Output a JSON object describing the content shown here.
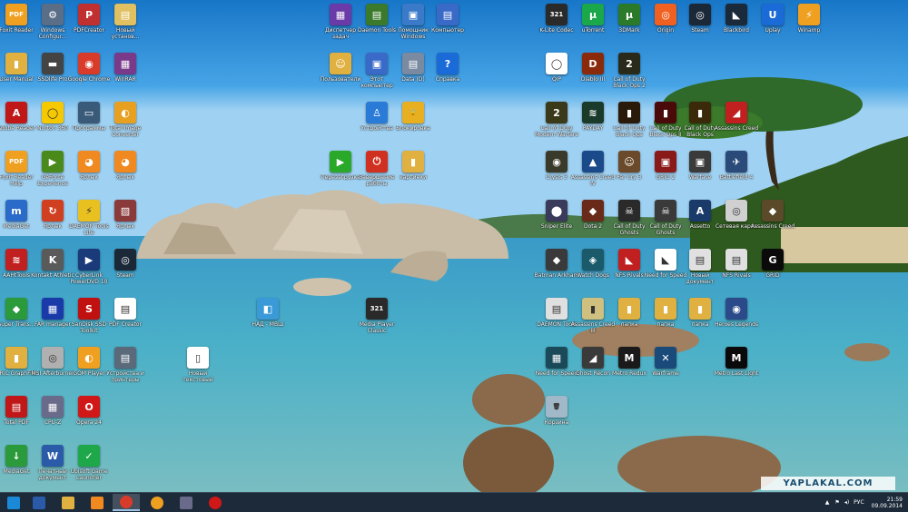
{
  "desktop": {
    "icons": [
      {
        "label": "Foxit Reader",
        "color": "#f0a020",
        "glyph": "PDF",
        "icon": "foxit-icon"
      },
      {
        "label": "Windows Configur...",
        "color": "#5a6e88",
        "glyph": "⚙",
        "icon": "settings-icon"
      },
      {
        "label": "PDFCreator",
        "color": "#c03030",
        "glyph": "P",
        "icon": "pdfcreator-icon"
      },
      {
        "label": "Новый установ...",
        "color": "#e0c060",
        "glyph": "▤",
        "icon": "document-icon"
      },
      {
        "label": "User Manual",
        "color": "#e0b040",
        "glyph": "▮",
        "icon": "folder-icon"
      },
      {
        "label": "SSDlife Pro",
        "color": "#444444",
        "glyph": "▬",
        "icon": "ssd-icon"
      },
      {
        "label": "Google Chrome",
        "color": "#d93b2b",
        "glyph": "◉",
        "icon": "chrome-icon"
      },
      {
        "label": "WinRAR",
        "color": "#7a3a8a",
        "glyph": "▦",
        "icon": "winrar-icon"
      },
      {
        "label": "Adobe Reader",
        "color": "#c01818",
        "glyph": "A",
        "icon": "adobe-reader-icon"
      },
      {
        "label": "Norton 360",
        "color": "#f5c800",
        "glyph": "◯",
        "icon": "norton-icon"
      },
      {
        "label": "Программы",
        "color": "#3a5a7a",
        "glyph": "▭",
        "icon": "programs-icon"
      },
      {
        "label": "Total Image Converter",
        "color": "#e8a020",
        "glyph": "◐",
        "icon": "converter-icon"
      },
      {
        "label": "Foxit Reader Help",
        "color": "#f0a020",
        "glyph": "PDF",
        "icon": "pdf-help-icon"
      },
      {
        "label": "GeForce Experience",
        "color": "#4a8a1a",
        "glyph": "▶",
        "icon": "geforce-icon"
      },
      {
        "label": "Ярлык",
        "color": "#f08a20",
        "glyph": "◕",
        "icon": "shortcut-icon"
      },
      {
        "label": "Ярлык",
        "color": "#f08a20",
        "glyph": "◕",
        "icon": "shortcut-icon"
      },
      {
        "label": "MediaGet",
        "color": "#2a6ac8",
        "glyph": "m",
        "icon": "mediaget-icon"
      },
      {
        "label": "Ярлык",
        "color": "#d04020",
        "glyph": "↻",
        "icon": "shortcut-icon"
      },
      {
        "label": "DAEMON Tools Lite",
        "color": "#e8c020",
        "glyph": "⚡",
        "icon": "daemon-icon"
      },
      {
        "label": "Ярлык",
        "color": "#8a3a3a",
        "glyph": "▨",
        "icon": "shortcut-icon"
      },
      {
        "label": "AAHtTools",
        "color": "#c02020",
        "glyph": "≋",
        "icon": "tools-icon"
      },
      {
        "label": "Kontakt Athletic",
        "color": "#5a5a5a",
        "glyph": "K",
        "icon": "k-icon"
      },
      {
        "label": "CyberLink PowerDVD 10",
        "color": "#1a3a7a",
        "glyph": "▶",
        "icon": "powerdvd-icon"
      },
      {
        "label": "Steam",
        "color": "#1b2838",
        "glyph": "◎",
        "icon": "steam-icon"
      },
      {
        "label": "Super Trans...",
        "color": "#2a9a3a",
        "glyph": "◆",
        "icon": "transfer-icon"
      },
      {
        "label": "FAR manager",
        "color": "#1a3aaa",
        "glyph": "▦",
        "icon": "far-icon"
      },
      {
        "label": "SanDisk SSD Toolkit",
        "color": "#c01010",
        "glyph": "S",
        "icon": "sandisk-icon"
      },
      {
        "label": "PDF Creator",
        "color": "#ffffff",
        "glyph": "▤",
        "icon": "pdf-icon"
      },
      {
        "label": "ERIC GraphFile",
        "color": "#e0b040",
        "glyph": "▮",
        "icon": "folder-icon"
      },
      {
        "label": "MSI Afterburner",
        "color": "#b0b0b0",
        "glyph": "◎",
        "icon": "afterburner-icon"
      },
      {
        "label": "GOM Player",
        "color": "#f0a020",
        "glyph": "◐",
        "icon": "gom-icon"
      },
      {
        "label": "Устройства и принтеры",
        "color": "#5a6a7a",
        "glyph": "▤",
        "icon": "printer-icon"
      },
      {
        "label": "Новый текстовый",
        "color": "#ffffff",
        "glyph": "▯",
        "icon": "text-file-icon"
      },
      {
        "label": "Total PDF",
        "color": "#c01818",
        "glyph": "▤",
        "icon": "pdf-icon"
      },
      {
        "label": "CPU-Z",
        "color": "#6a6a8a",
        "glyph": "▦",
        "icon": "cpuz-icon"
      },
      {
        "label": "Opera 24",
        "color": "#d01818",
        "glyph": "O",
        "icon": "opera-icon"
      },
      {
        "label": "MediaGet",
        "color": "#2a9a3a",
        "glyph": "↓",
        "icon": "mediaget-icon"
      },
      {
        "label": "Печатный документ",
        "color": "#2a5aa8",
        "glyph": "W",
        "icon": "word-icon"
      },
      {
        "label": "Ubisoft Game Launcher",
        "color": "#1fa84a",
        "glyph": "✓",
        "icon": "launcher-icon"
      },
      {
        "label": "Диспетчер задач",
        "color": "#6a3aa8",
        "glyph": "▦",
        "icon": "taskmgr-icon"
      },
      {
        "label": "Daemon Tools",
        "color": "#3a7a2a",
        "glyph": "▤",
        "icon": "image-icon"
      },
      {
        "label": "Помощник Windows",
        "color": "#3a7ac8",
        "glyph": "▣",
        "icon": "window-icon"
      },
      {
        "label": "Компьютер",
        "color": "#3a6ac8",
        "glyph": "▤",
        "icon": "computer-icon"
      },
      {
        "label": "Пользователи",
        "color": "#e0b040",
        "glyph": "☺",
        "icon": "users-icon"
      },
      {
        "label": "Этот компьютер",
        "color": "#3a6ac8",
        "glyph": "▣",
        "icon": "pc-icon"
      },
      {
        "label": "Data (D)",
        "color": "#7a8aa0",
        "glyph": "▤",
        "icon": "disk-icon"
      },
      {
        "label": "Справка",
        "color": "#1a6ad8",
        "glyph": "?",
        "icon": "help-icon"
      },
      {
        "label": "Устройства",
        "color": "#2a7ad8",
        "glyph": "♙",
        "icon": "devices-icon"
      },
      {
        "label": "Блокировка",
        "color": "#e8b020",
        "glyph": "🔒",
        "icon": "lock-icon"
      },
      {
        "label": "Перезагрузка",
        "color": "#2aa82a",
        "glyph": "▶",
        "icon": "restart-icon"
      },
      {
        "label": "Завершение работы",
        "color": "#d03020",
        "glyph": "⏻",
        "icon": "power-icon"
      },
      {
        "label": "картинки",
        "color": "#e0b040",
        "glyph": "▮",
        "icon": "folder-icon"
      },
      {
        "label": "НАД - МВШ",
        "color": "#3a9ad8",
        "glyph": "◧",
        "icon": "program-icon"
      },
      {
        "label": "Media Player Classic",
        "color": "#2a2a2a",
        "glyph": "321",
        "icon": "mpc-icon"
      },
      {
        "label": "K-Lite Codec",
        "color": "#2a2a2a",
        "glyph": "321",
        "icon": "klite-icon"
      },
      {
        "label": "uTorrent",
        "color": "#1aa84a",
        "glyph": "µ",
        "icon": "utorrent-icon"
      },
      {
        "label": "3DMark",
        "color": "#2a7a2a",
        "glyph": "µ",
        "icon": "utorrent-icon"
      },
      {
        "label": "Origin",
        "color": "#f06020",
        "glyph": "◎",
        "icon": "origin-icon"
      },
      {
        "label": "Steam",
        "color": "#1b2838",
        "glyph": "◎",
        "icon": "steam-icon"
      },
      {
        "label": "Blackbird",
        "color": "#1a2a3a",
        "glyph": "◣",
        "icon": "blackbird-icon"
      },
      {
        "label": "Uplay",
        "color": "#1a6ad8",
        "glyph": "U",
        "icon": "uplay-icon"
      },
      {
        "label": "Winamp",
        "color": "#f0a020",
        "glyph": "⚡",
        "icon": "winamp-icon"
      },
      {
        "label": "QIP",
        "color": "#ffffff",
        "glyph": "◯",
        "icon": "chat-icon"
      },
      {
        "label": "Diablo III",
        "color": "#8a2a0a",
        "glyph": "D",
        "icon": "diablo-icon"
      },
      {
        "label": "Call of Duty Black Ops 2",
        "color": "#2a2a1a",
        "glyph": "2",
        "icon": "cod-icon"
      },
      {
        "label": "Call of Duty Modern Warfare",
        "color": "#3a3a1a",
        "glyph": "2",
        "icon": "cod-icon"
      },
      {
        "label": "PAYDAY",
        "color": "#1a3a2a",
        "glyph": "≋",
        "icon": "game-icon"
      },
      {
        "label": "Call of Duty Black Ops",
        "color": "#2a1a0a",
        "glyph": "▮",
        "icon": "cod-icon"
      },
      {
        "label": "Call of Duty Black Ops II",
        "color": "#4a0a0a",
        "glyph": "▮",
        "icon": "cod-icon"
      },
      {
        "label": "Call of Duty Black Ops",
        "color": "#3a2a0a",
        "glyph": "▮",
        "icon": "cod-icon"
      },
      {
        "label": "Assassins Creed",
        "color": "#c02020",
        "glyph": "◢",
        "icon": "game-icon"
      },
      {
        "label": "Crysis 3",
        "color": "#3a3a2a",
        "glyph": "◉",
        "icon": "game-icon"
      },
      {
        "label": "Assassins Creed IV",
        "color": "#1a4a8a",
        "glyph": "▲",
        "icon": "game-icon"
      },
      {
        "label": "Far Cry 3",
        "color": "#6a4a2a",
        "glyph": "☺",
        "icon": "game-icon"
      },
      {
        "label": "GRID 2",
        "color": "#8a1a1a",
        "glyph": "▣",
        "icon": "game-icon"
      },
      {
        "label": "Warface",
        "color": "#3a3a3a",
        "glyph": "▣",
        "icon": "game-icon"
      },
      {
        "label": "Battlefield 4",
        "color": "#2a4a7a",
        "glyph": "✈",
        "icon": "game-icon"
      },
      {
        "label": "Sniper Elite",
        "color": "#3a3a5a",
        "glyph": "⬤",
        "icon": "game-icon"
      },
      {
        "label": "Dota 2",
        "color": "#6a2a1a",
        "glyph": "◆",
        "icon": "game-icon"
      },
      {
        "label": "Call of Duty Ghosts",
        "color": "#2a2a2a",
        "glyph": "☠",
        "icon": "game-icon"
      },
      {
        "label": "Call of Duty Ghosts",
        "color": "#3a3a3a",
        "glyph": "☠",
        "icon": "game-icon"
      },
      {
        "label": "Assetto",
        "color": "#1a3a6a",
        "glyph": "A",
        "icon": "game-icon"
      },
      {
        "label": "Сетевая карта",
        "color": "#d0d0d0",
        "glyph": "◎",
        "icon": "network-icon"
      },
      {
        "label": "Assassins Creed",
        "color": "#5a4a2a",
        "glyph": "◆",
        "icon": "game-icon"
      },
      {
        "label": "Batman Arkham",
        "color": "#3a3a3a",
        "glyph": "◆",
        "icon": "game-icon"
      },
      {
        "label": "Watch Dogs",
        "color": "#1a5a6a",
        "glyph": "◈",
        "icon": "game-icon"
      },
      {
        "label": "NFS Rivals",
        "color": "#c02020",
        "glyph": "◣",
        "icon": "nfs-icon"
      },
      {
        "label": "Need for Speed",
        "color": "#ffffff",
        "glyph": "◣",
        "icon": "nfs-icon"
      },
      {
        "label": "Новый документ",
        "color": "#e0e0e0",
        "glyph": "▤",
        "icon": "document-icon"
      },
      {
        "label": "NFS Rivals",
        "color": "#e0e0e0",
        "glyph": "▤",
        "icon": "document-icon"
      },
      {
        "label": "GRID",
        "color": "#0a0a0a",
        "glyph": "G",
        "icon": "grid-icon"
      },
      {
        "label": "DAEMON Tools",
        "color": "#e0e0e0",
        "glyph": "▤",
        "icon": "document-icon"
      },
      {
        "label": "Assassins Creed III",
        "color": "#d0c080",
        "glyph": "▮",
        "icon": "folder-icon"
      },
      {
        "label": "папка",
        "color": "#e0b040",
        "glyph": "▮",
        "icon": "folder-icon"
      },
      {
        "label": "папка",
        "color": "#e0b040",
        "glyph": "▮",
        "icon": "folder-icon"
      },
      {
        "label": "папка",
        "color": "#e0b040",
        "glyph": "▮",
        "icon": "folder-icon"
      },
      {
        "label": "Heroes Legends",
        "color": "#2a4a8a",
        "glyph": "◉",
        "icon": "game-icon"
      },
      {
        "label": "Need for Speed",
        "color": "#1a4a5a",
        "glyph": "▦",
        "icon": "game-icon"
      },
      {
        "label": "Ghost Recon",
        "color": "#3a3a3a",
        "glyph": "◢",
        "icon": "game-icon"
      },
      {
        "label": "Metro Redux",
        "color": "#1a1a1a",
        "glyph": "M",
        "icon": "game-icon"
      },
      {
        "label": "Warframe",
        "color": "#1a4a7a",
        "glyph": "✕",
        "icon": "game-icon"
      },
      {
        "label": "Metro Last Light",
        "color": "#0a0a0a",
        "glyph": "M",
        "icon": "metro-icon"
      },
      {
        "label": "Корзина",
        "color": "#a0b8c8",
        "glyph": "🗑",
        "icon": "recycle-bin-icon"
      }
    ]
  },
  "taskbar": {
    "items": [
      {
        "icon": "windows-start-icon",
        "color": "#1a8ad8"
      },
      {
        "icon": "word-icon",
        "color": "#2a5aa8"
      },
      {
        "icon": "file-explorer-icon",
        "color": "#e0b040"
      },
      {
        "icon": "shortcut-icon",
        "color": "#f08a20"
      },
      {
        "icon": "chrome-icon",
        "color": "#d93b2b"
      },
      {
        "icon": "browser-icon",
        "color": "#f0a020"
      },
      {
        "icon": "taskmgr-icon",
        "color": "#6a6a8a"
      },
      {
        "icon": "opera-icon",
        "color": "#d01818"
      }
    ],
    "tray": {
      "lang": "РУС",
      "time": "21:59",
      "date": "09.09.2014"
    }
  },
  "watermark": "YAPLAKAL.COM"
}
